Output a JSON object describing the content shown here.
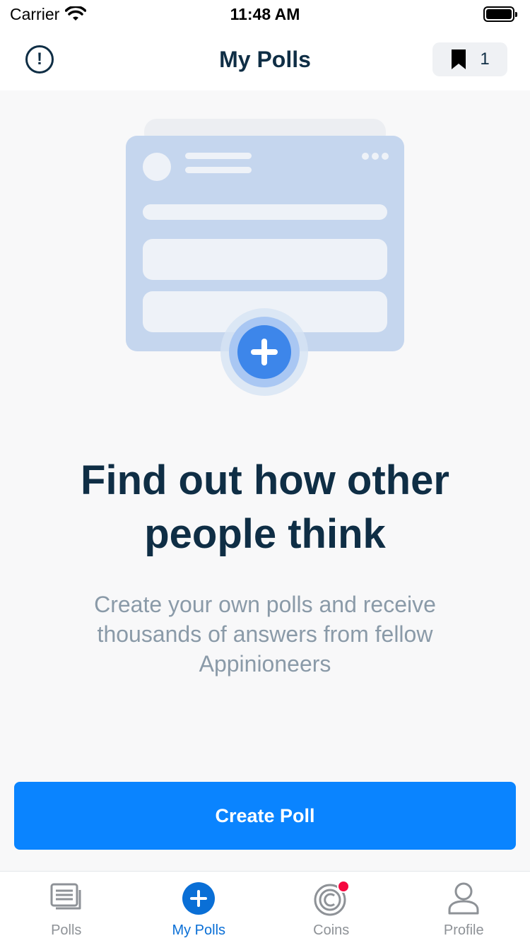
{
  "status_bar": {
    "carrier": "Carrier",
    "time": "11:48 AM"
  },
  "nav": {
    "title": "My Polls",
    "bookmark_count": "1"
  },
  "empty_state": {
    "headline": "Find out how other people think",
    "subtext": "Create your own polls and receive thousands of answers from fellow Appinioneers"
  },
  "cta": {
    "label": "Create Poll"
  },
  "tabs": [
    {
      "label": "Polls",
      "icon": "polls-icon",
      "active": false
    },
    {
      "label": "My Polls",
      "icon": "add-circle-icon",
      "active": true
    },
    {
      "label": "Coins",
      "icon": "coins-icon",
      "active": false,
      "has_notification": true
    },
    {
      "label": "Profile",
      "icon": "profile-icon",
      "active": false
    }
  ],
  "colors": {
    "primary": "#0a84ff",
    "title_text": "#0f2e45",
    "secondary_text": "#8a9aa8",
    "notification": "#f5073f",
    "illustration_card": "#c5d6ee"
  }
}
